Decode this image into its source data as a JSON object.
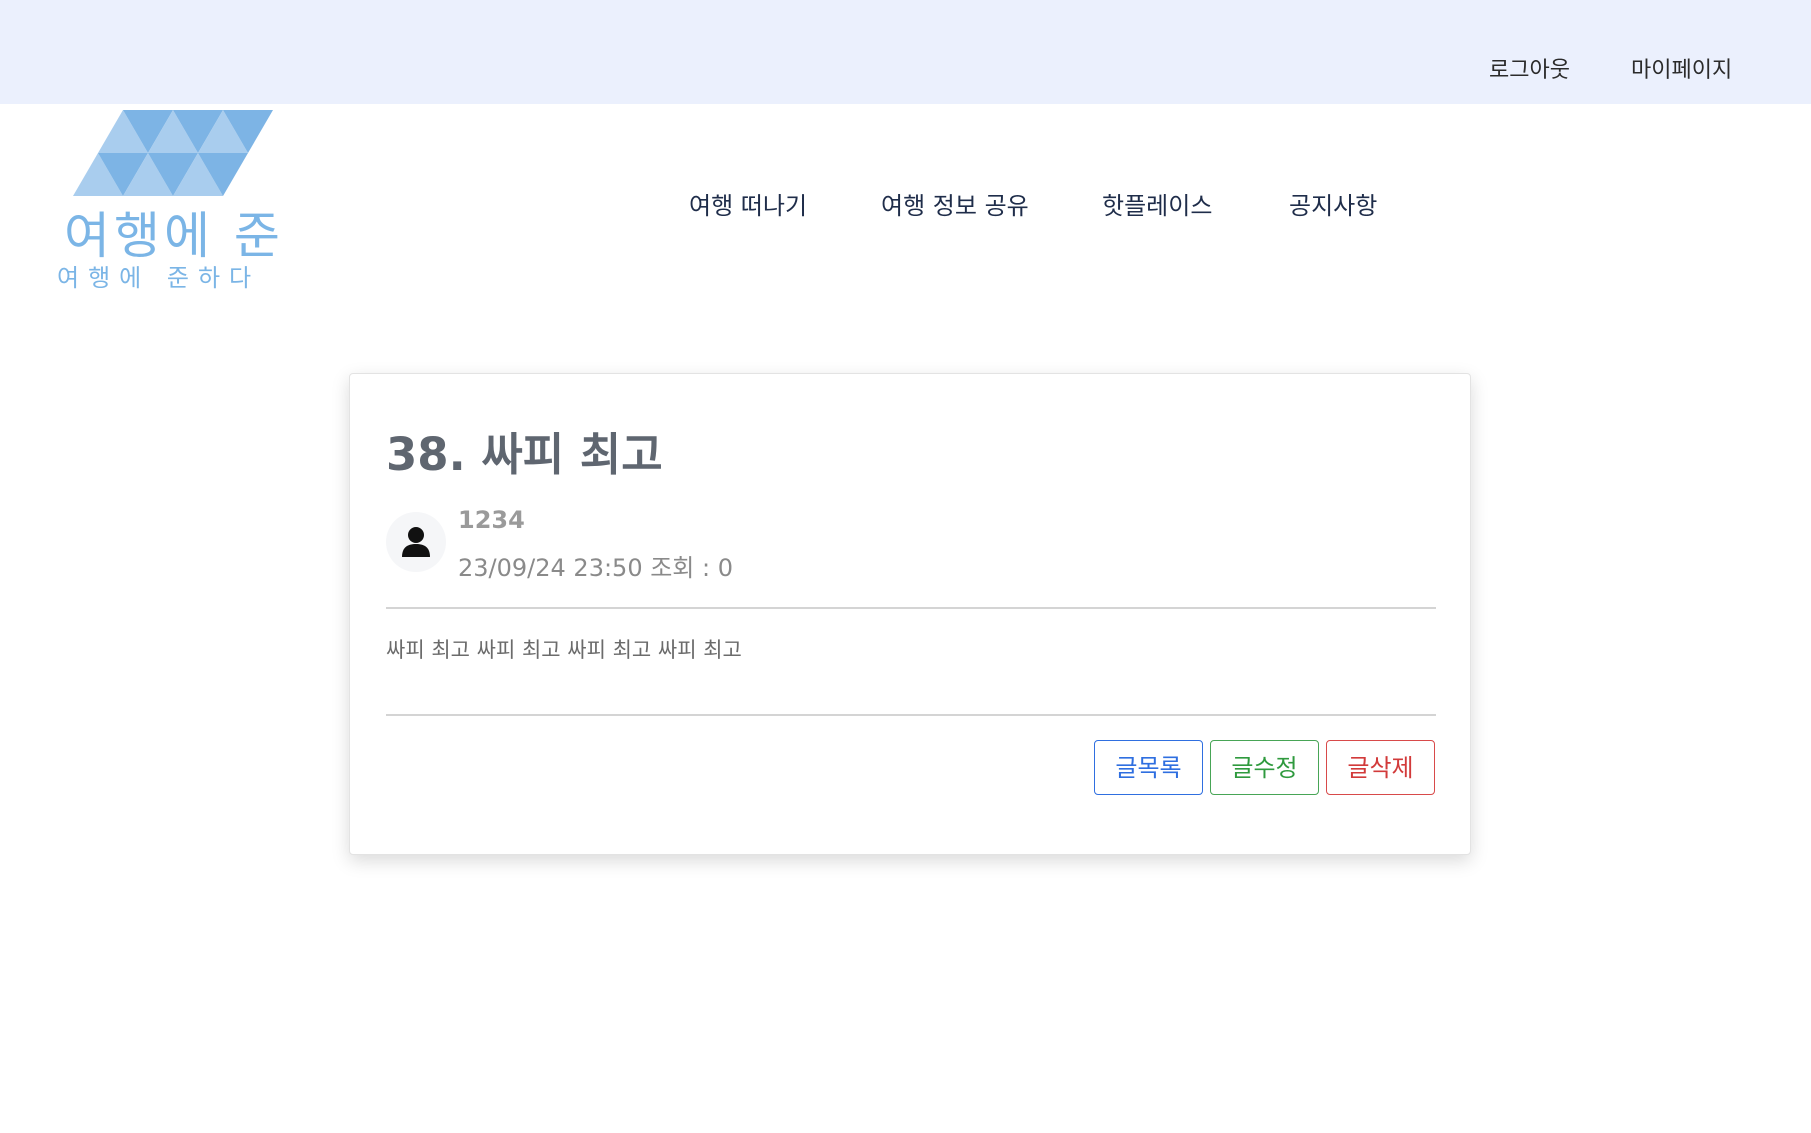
{
  "topbar": {
    "logout_label": "로그아웃",
    "mypage_label": "마이페이지"
  },
  "logo": {
    "title": "여행에 준",
    "subtitle": "여행에 준하다",
    "color": "#7bb5e6"
  },
  "nav": {
    "items": [
      {
        "label": "여행 떠나기"
      },
      {
        "label": "여행 정보 공유"
      },
      {
        "label": "핫플레이스"
      },
      {
        "label": "공지사항"
      }
    ]
  },
  "post": {
    "title": "38. 싸피 최고",
    "author": "1234",
    "meta": "23/09/24 23:50 조회 : 0",
    "content": "싸피 최고 싸피 최고 싸피 최고 싸피 최고",
    "avatar_icon": "user-icon"
  },
  "actions": {
    "list_label": "글목록",
    "edit_label": "글수정",
    "delete_label": "글삭제"
  },
  "colors": {
    "topbar_bg": "#ebf0fd",
    "primary": "#2f6fe0",
    "success": "#2f9a3e",
    "danger": "#d23a3a"
  }
}
